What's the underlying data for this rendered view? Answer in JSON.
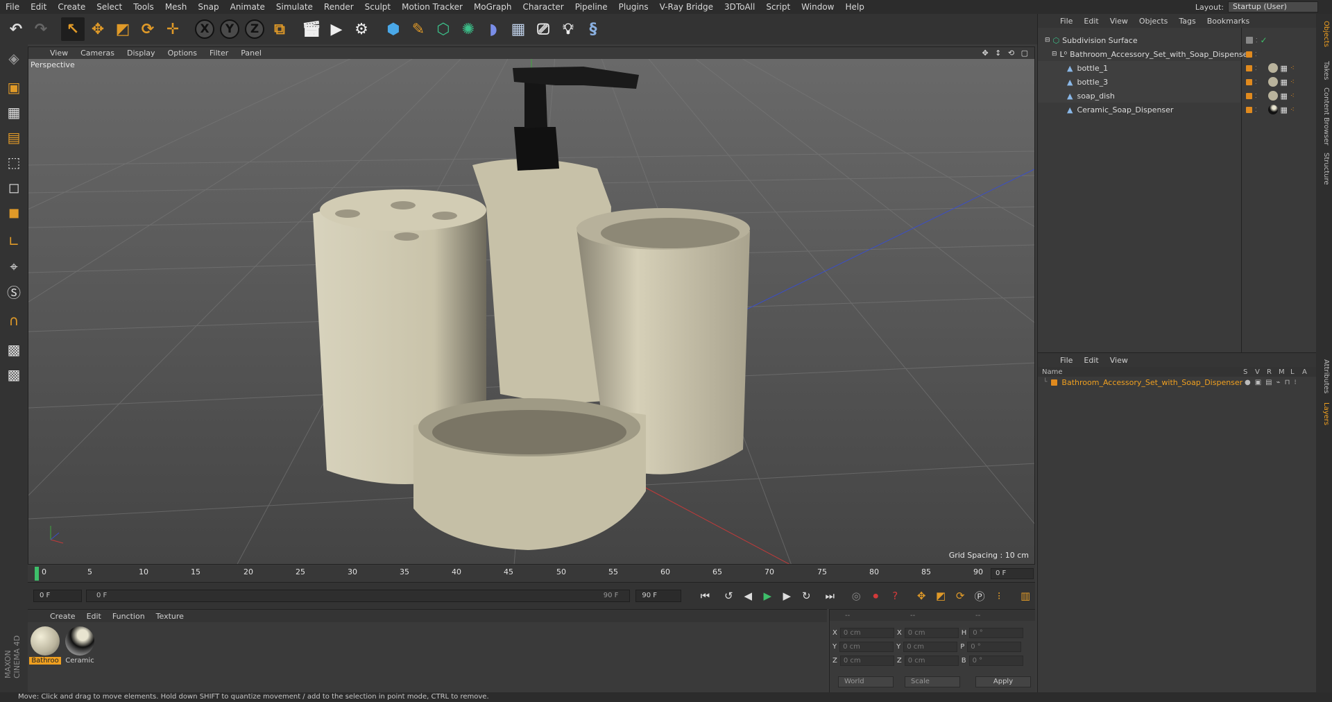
{
  "menubar": {
    "items": [
      "File",
      "Edit",
      "Create",
      "Select",
      "Tools",
      "Mesh",
      "Snap",
      "Animate",
      "Simulate",
      "Render",
      "Sculpt",
      "Motion Tracker",
      "MoGraph",
      "Character",
      "Pipeline",
      "Plugins",
      "V-Ray Bridge",
      "3DToAll",
      "Script",
      "Window",
      "Help"
    ],
    "layout_label": "Layout:",
    "layout_value": "Startup (User)"
  },
  "toolbar": {
    "axis_x": "X",
    "axis_y": "Y",
    "axis_z": "Z"
  },
  "brand": "MAXON CINEMA 4D",
  "viewport": {
    "menu": [
      "View",
      "Cameras",
      "Display",
      "Options",
      "Filter",
      "Panel"
    ],
    "camera_label": "Perspective",
    "grid_spacing": "Grid Spacing : 10 cm",
    "nav_icons": "✥ ↕ ⟲ ▢"
  },
  "timeline": {
    "ticks": [
      "0",
      "5",
      "10",
      "15",
      "20",
      "25",
      "30",
      "35",
      "40",
      "45",
      "50",
      "55",
      "60",
      "65",
      "70",
      "75",
      "80",
      "85",
      "90"
    ],
    "current_frame": "0 F"
  },
  "transport": {
    "start_field": "0 F",
    "range_start": "0 F",
    "range_end": "90 F",
    "end_field": "90 F"
  },
  "materials": {
    "menu": [
      "Create",
      "Edit",
      "Function",
      "Texture"
    ],
    "items": [
      {
        "label": "Bathroo"
      },
      {
        "label": "Ceramic"
      }
    ]
  },
  "coords": {
    "header": [
      "--",
      "--",
      "--"
    ],
    "rows": [
      {
        "a": "X",
        "av": "0 cm",
        "b": "X",
        "bv": "0 cm",
        "c": "H",
        "cv": "0 °"
      },
      {
        "a": "Y",
        "av": "0 cm",
        "b": "Y",
        "bv": "0 cm",
        "c": "P",
        "cv": "0 °"
      },
      {
        "a": "Z",
        "av": "0 cm",
        "b": "Z",
        "bv": "0 cm",
        "c": "B",
        "cv": "0 °"
      }
    ],
    "world": "World",
    "scale": "Scale",
    "apply": "Apply"
  },
  "objects": {
    "menu": [
      "File",
      "Edit",
      "View",
      "Objects",
      "Tags",
      "Bookmarks"
    ],
    "tree": [
      {
        "name": "Subdivision Surface"
      },
      {
        "name": "Bathroom_Accessory_Set_with_Soap_Dispenser"
      },
      {
        "name": "bottle_1"
      },
      {
        "name": "bottle_3"
      },
      {
        "name": "soap_dish"
      },
      {
        "name": "Ceramic_Soap_Dispenser"
      }
    ]
  },
  "layers": {
    "menu": [
      "File",
      "Edit",
      "View"
    ],
    "header_name": "Name",
    "header_cols": [
      "S",
      "V",
      "R",
      "M",
      "L",
      "A"
    ],
    "items": [
      {
        "name": "Bathroom_Accessory_Set_with_Soap_Dispenser"
      }
    ]
  },
  "sidetabs": [
    "Objects",
    "Takes",
    "Content Browser",
    "Structure",
    "Attributes",
    "Layers"
  ],
  "status": "Move: Click and drag to move elements. Hold down SHIFT to quantize movement / add to the selection in point mode, CTRL to remove.",
  "colors": {
    "accent": "#e08a1e",
    "selection": "#f0a020",
    "x_axis": "#c23a3a",
    "y_axis": "#3ea83e",
    "z_axis": "#3a4ec8"
  }
}
